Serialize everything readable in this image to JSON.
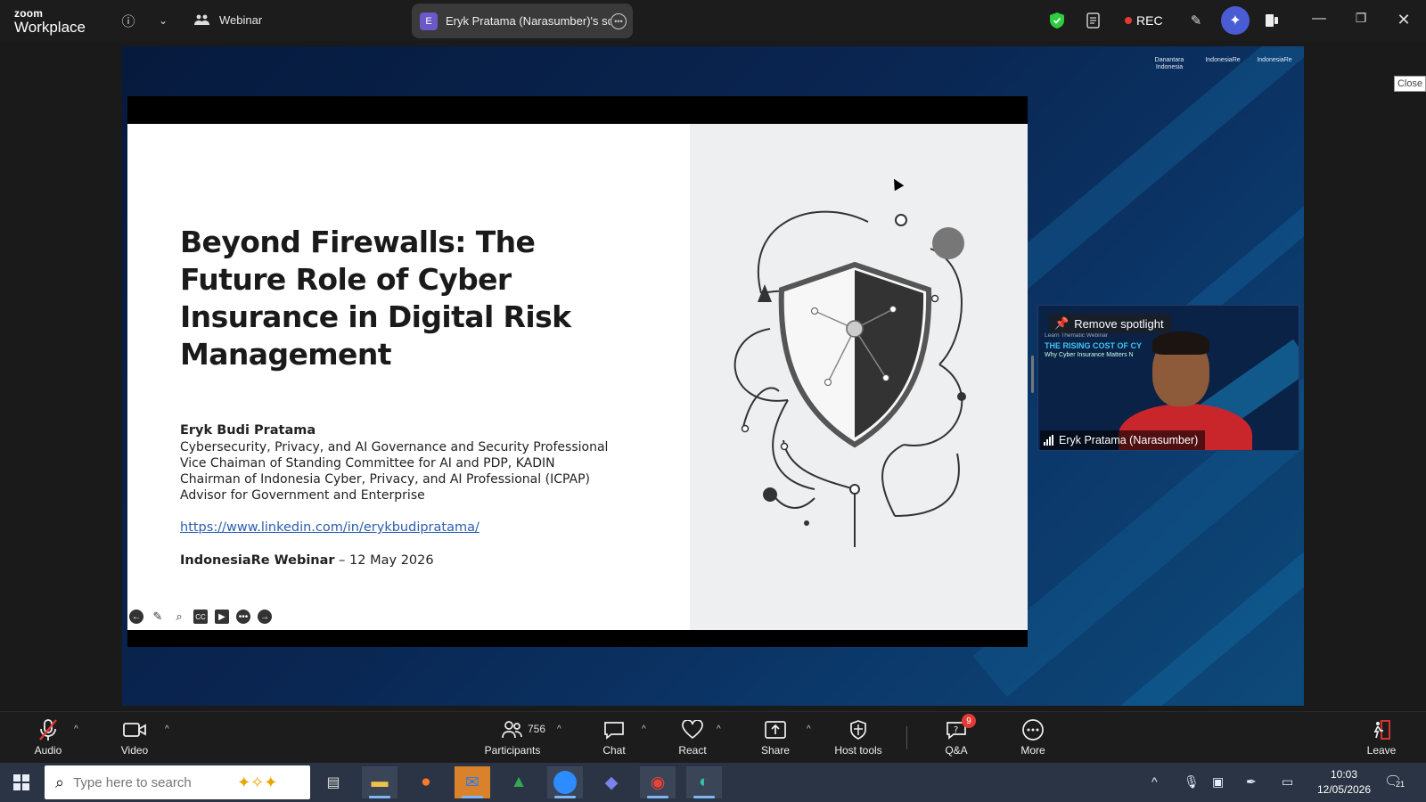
{
  "app": {
    "logo_line1": "zoom",
    "logo_line2": "Workplace",
    "webinar_label": "Webinar"
  },
  "share_tab": {
    "badge": "E",
    "label": "Eryk Pratama (Narasumber)'s scre"
  },
  "rec": {
    "label": "REC"
  },
  "close_chip": "Close",
  "backdrop": {
    "sponsor_1": "Danantara Indonesia",
    "sponsor_2": "IndonesiaRe",
    "sponsor_3": "IndonesiaRe"
  },
  "slide": {
    "title": "Beyond Firewalls: The Future Role of Cyber Insurance in Digital Risk Management",
    "author_name": "Eryk Budi Pratama",
    "roles": [
      "Cybersecurity, Privacy, and AI Governance and Security Professional",
      "Vice Chaiman of Standing Committee for AI and PDP, KADIN",
      "Chairman of Indonesia Cyber, Privacy, and AI Professional (ICPAP)",
      "Advisor for Government and Enterprise"
    ],
    "link": "https://www.linkedin.com/in/erykbudipratama/",
    "event_name": "IndonesiaRe Webinar",
    "event_date": " – 12 May 2026"
  },
  "video_tile": {
    "spotlight_label": "Remove spotlight",
    "banner_small": "Learn Thematic Webinar",
    "banner_title": "THE RISING COST OF CY",
    "banner_sub": "Why Cyber Insurance Matters N",
    "participant_name": "Eryk Pratama (Narasumber)"
  },
  "toolbar": {
    "audio": "Audio",
    "video": "Video",
    "participants": "Participants",
    "participant_count": "756",
    "chat": "Chat",
    "react": "React",
    "share": "Share",
    "host_tools": "Host tools",
    "qa": "Q&A",
    "qa_badge": "9",
    "more": "More",
    "leave": "Leave"
  },
  "taskbar": {
    "search_placeholder": "Type here to search",
    "time": "10:03",
    "date": "12/05/2026",
    "notification_count": "21"
  }
}
